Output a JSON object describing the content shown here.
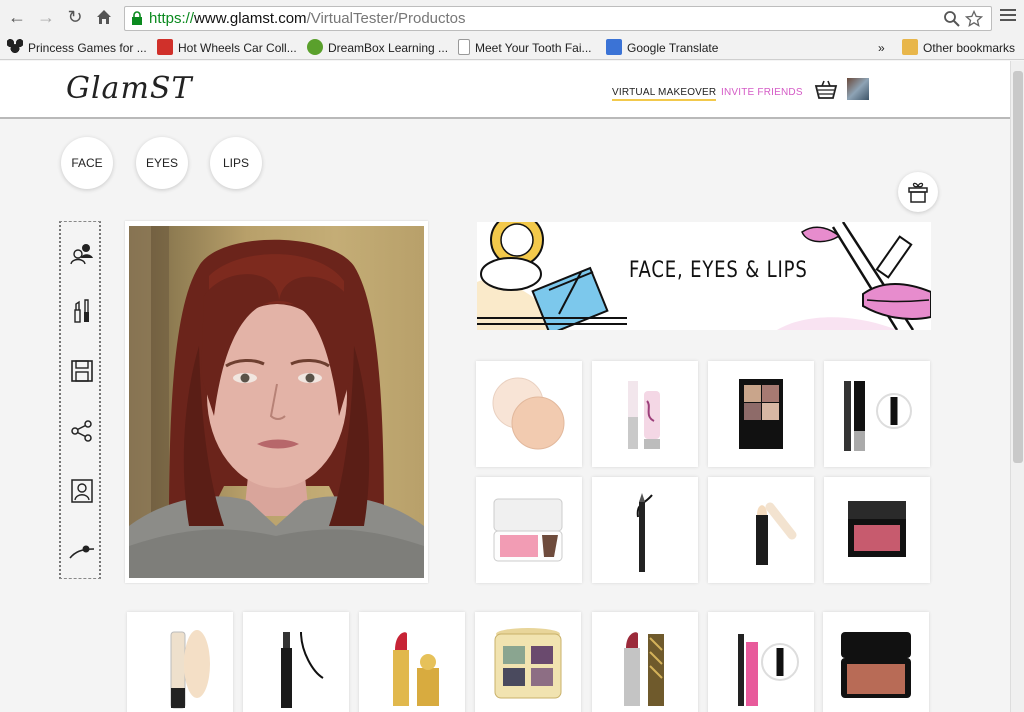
{
  "browser": {
    "url_scheme": "https://",
    "url_host": "www.glamst.com",
    "url_path": "/VirtualTester/Productos",
    "bookmarks": [
      {
        "label": "Princess Games for ...",
        "color": "#333333"
      },
      {
        "label": "Hot Wheels Car Coll...",
        "color": "#d0302a"
      },
      {
        "label": "DreamBox Learning ...",
        "color": "#5aa02c"
      },
      {
        "label": "Meet Your Tooth Fai...",
        "color": "#dddddd"
      },
      {
        "label": "Google Translate",
        "color": "#3b73d6"
      }
    ],
    "more_chevron": "»",
    "other_bookmarks": "Other bookmarks"
  },
  "site": {
    "logo": "GlamST",
    "nav": {
      "virtual_makeover": "VIRTUAL MAKEOVER",
      "invite_friends": "INVITE FRIENDS"
    },
    "categories": [
      "FACE",
      "EYES",
      "LIPS"
    ],
    "banner_title": "FACE, EYES & LIPS",
    "accent_colors": {
      "yellow": "#f2c94c",
      "pink": "#d45bc6",
      "blue": "#7cc8ec"
    }
  },
  "tools": [
    {
      "name": "compare-users-icon"
    },
    {
      "name": "makeup-tools-icon"
    },
    {
      "name": "save-icon"
    },
    {
      "name": "share-icon"
    },
    {
      "name": "portrait-icon"
    },
    {
      "name": "intensity-slider-icon"
    }
  ],
  "products": [
    {
      "name": "face-powder"
    },
    {
      "name": "lip-gloss"
    },
    {
      "name": "eyeshadow-quad"
    },
    {
      "name": "mascara"
    },
    {
      "name": "blush-compact"
    },
    {
      "name": "eyeliner-pencil"
    },
    {
      "name": "concealer"
    },
    {
      "name": "blush-palette"
    },
    {
      "name": "foundation"
    },
    {
      "name": "liquid-eyeliner"
    },
    {
      "name": "red-lipstick"
    },
    {
      "name": "eyeshadow-palette"
    },
    {
      "name": "lipstick"
    },
    {
      "name": "mascara-2"
    },
    {
      "name": "blush-compact-2"
    }
  ]
}
